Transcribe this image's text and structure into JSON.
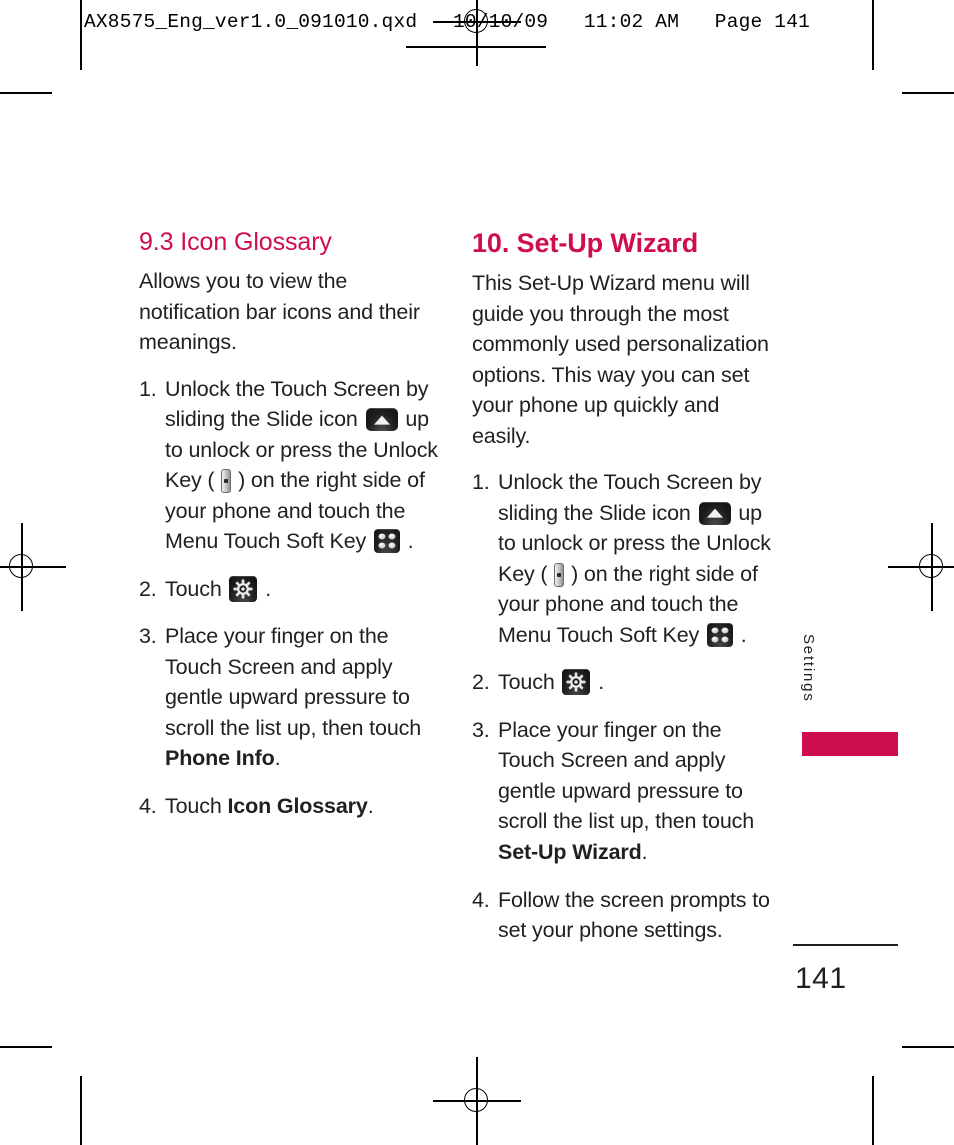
{
  "print_slug": "AX8575_Eng_ver1.0_091010.qxd   10/10/09   11:02 AM   Page 141",
  "colors": {
    "accent": "#ce0e4e",
    "text": "#231f20"
  },
  "left_column": {
    "heading": "9.3 Icon Glossary",
    "intro": "Allows you to view the notification bar icons and their meanings.",
    "steps": [
      {
        "number": "1.",
        "parts": [
          {
            "type": "text",
            "value": "Unlock the Touch Screen by sliding the Slide icon "
          },
          {
            "type": "icon",
            "value": "slide-up-icon"
          },
          {
            "type": "text",
            "value": " up to unlock or press the Unlock Key ( "
          },
          {
            "type": "icon",
            "value": "unlock-key-icon"
          },
          {
            "type": "text",
            "value": " ) on the right side of your phone and touch the Menu Touch Soft Key "
          },
          {
            "type": "icon",
            "value": "menu-touch-soft-key-icon"
          },
          {
            "type": "text",
            "value": " ."
          }
        ]
      },
      {
        "number": "2.",
        "parts": [
          {
            "type": "text",
            "value": "Touch "
          },
          {
            "type": "icon",
            "value": "settings-gear-icon"
          },
          {
            "type": "text",
            "value": " ."
          }
        ]
      },
      {
        "number": "3.",
        "parts": [
          {
            "type": "text",
            "value": "Place your finger on the Touch Screen and apply gentle upward pressure to scroll the list up, then touch "
          },
          {
            "type": "bold",
            "value": "Phone Info"
          },
          {
            "type": "text",
            "value": "."
          }
        ]
      },
      {
        "number": "4.",
        "parts": [
          {
            "type": "text",
            "value": "Touch "
          },
          {
            "type": "bold",
            "value": "Icon Glossary"
          },
          {
            "type": "text",
            "value": "."
          }
        ]
      }
    ]
  },
  "right_column": {
    "heading": "10. Set-Up Wizard",
    "intro": "This Set-Up Wizard menu will guide you through the most commonly used personalization options. This way you can set your phone up quickly and easily.",
    "steps": [
      {
        "number": "1.",
        "parts": [
          {
            "type": "text",
            "value": "Unlock the Touch Screen by sliding the Slide icon "
          },
          {
            "type": "icon",
            "value": "slide-up-icon"
          },
          {
            "type": "text",
            "value": " up to unlock or press the Unlock Key ( "
          },
          {
            "type": "icon",
            "value": "unlock-key-icon"
          },
          {
            "type": "text",
            "value": " ) on the right side of your phone and touch the Menu Touch Soft Key "
          },
          {
            "type": "icon",
            "value": "menu-touch-soft-key-icon"
          },
          {
            "type": "text",
            "value": " ."
          }
        ]
      },
      {
        "number": "2.",
        "parts": [
          {
            "type": "text",
            "value": "Touch "
          },
          {
            "type": "icon",
            "value": "settings-gear-icon"
          },
          {
            "type": "text",
            "value": " ."
          }
        ]
      },
      {
        "number": "3.",
        "parts": [
          {
            "type": "text",
            "value": "Place your finger on the Touch Screen and apply gentle upward pressure to scroll the list up, then touch "
          },
          {
            "type": "bold",
            "value": "Set-Up Wizard"
          },
          {
            "type": "text",
            "value": "."
          }
        ]
      },
      {
        "number": "4.",
        "parts": [
          {
            "type": "text",
            "value": "Follow the screen prompts to set your phone settings."
          }
        ]
      }
    ]
  },
  "side_tab": {
    "label": "Settings"
  },
  "folio": {
    "page_number": "141"
  }
}
